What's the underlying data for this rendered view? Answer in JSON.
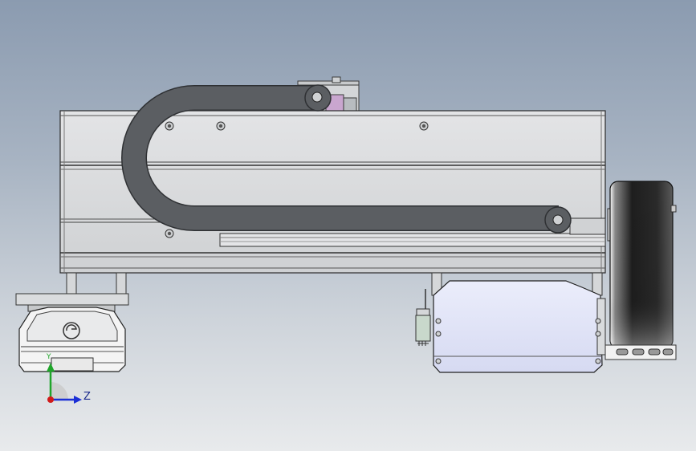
{
  "view": {
    "triad": {
      "y_axis_label": "Y",
      "z_axis_label": "Z",
      "y_axis_color": "#1fa52a",
      "z_axis_color": "#1b2fd6",
      "origin_color": "#d11a1a"
    },
    "colors": {
      "chain": "#5b5e62",
      "housing": "#d8dadc",
      "blue_part": "#dfe2f6",
      "wheel": "#2a2a2a"
    }
  }
}
